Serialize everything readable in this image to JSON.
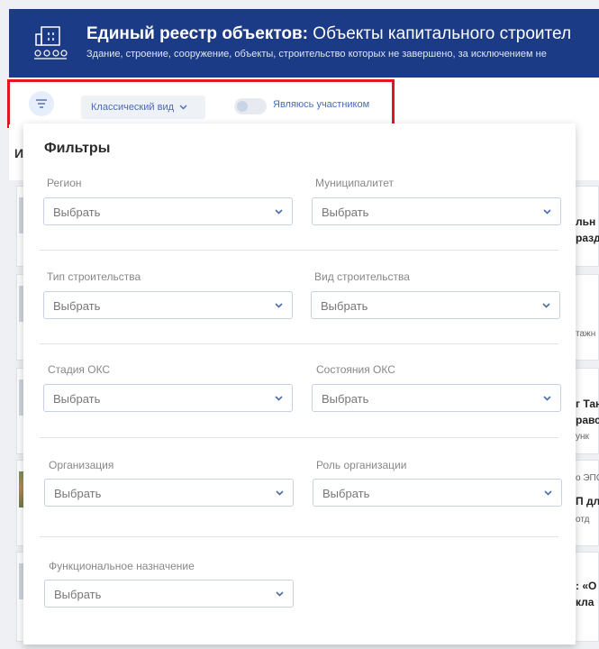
{
  "header": {
    "title_bold": "Единый реестр объектов:",
    "title_rest": "Объекты капитального строител",
    "subtitle": "Здание, строение, сооружение, объекты, строительство которых не завершено, за исключением не"
  },
  "toolbar": {
    "view_label": "Классический вид",
    "participant_label": "Являюсь участником",
    "participant_on": false
  },
  "background": {
    "column_header": "И",
    "peeks": [
      {
        "line1": "льн",
        "line2": "разд",
        "line3": ""
      },
      {
        "line1": "",
        "line2": "",
        "line3": "тажн"
      },
      {
        "line1": "г Тан",
        "line2": "равс",
        "line3": "унк"
      },
      {
        "line1": "о ЭПС",
        "line2": "П дл",
        "line3": "отд"
      },
      {
        "line1": ": «О",
        "line2": "кла",
        "line3": ""
      }
    ]
  },
  "filters": {
    "title": "Фильтры",
    "placeholder": "Выбрать",
    "labels": {
      "region": "Регион",
      "municipality": "Муниципалитет",
      "construction_type": "Тип строительства",
      "construction_kind": "Вид строительства",
      "oks_stage": "Стадия ОКС",
      "oks_state": "Состояния ОКС",
      "organization": "Организация",
      "org_role": "Роль организации",
      "function": "Функциональное назначение"
    }
  },
  "colors": {
    "header_bg": "#1c3b86",
    "accent": "#4a6bb5",
    "highlight": "#e3171b"
  }
}
